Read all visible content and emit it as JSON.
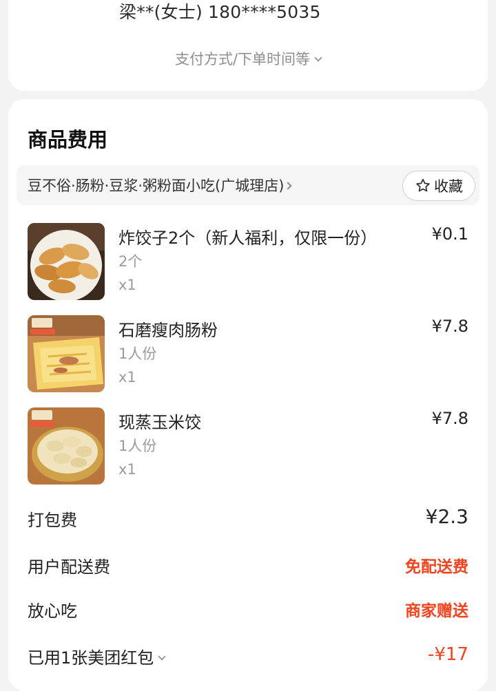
{
  "order_info": {
    "contact": "梁**(女士) 180****5035",
    "more_toggle_label": "支付方式/下单时间等"
  },
  "goods": {
    "section_title": "商品费用",
    "shop_name": "豆不俗·肠粉·豆浆·粥粉面小吃(广城理店)",
    "favorite_label": "收藏",
    "items": [
      {
        "name": "炸饺子2个（新人福利，仅限一份）",
        "spec": "2个",
        "qty": "x1",
        "price": "¥0.1"
      },
      {
        "name": "石磨瘦肉肠粉",
        "spec": "1人份",
        "qty": "x1",
        "price": "¥7.8"
      },
      {
        "name": "现蒸玉米饺",
        "spec": "1人份",
        "qty": "x1",
        "price": "¥7.8"
      }
    ],
    "fees": [
      {
        "label": "打包费",
        "value": "¥2.3"
      },
      {
        "label": "用户配送费",
        "value": "免配送费"
      },
      {
        "label": "放心吃",
        "value": "商家赠送"
      },
      {
        "label": "已用1张美团红包",
        "value": "-¥17"
      }
    ]
  },
  "colors": {
    "accent_red": "#f0431f",
    "background": "#f3f3f3",
    "card": "#ffffff"
  },
  "icons": {
    "favorite": "star-outline-icon",
    "shop_arrow": "chevron-right-icon",
    "expand": "chevron-down-icon"
  }
}
